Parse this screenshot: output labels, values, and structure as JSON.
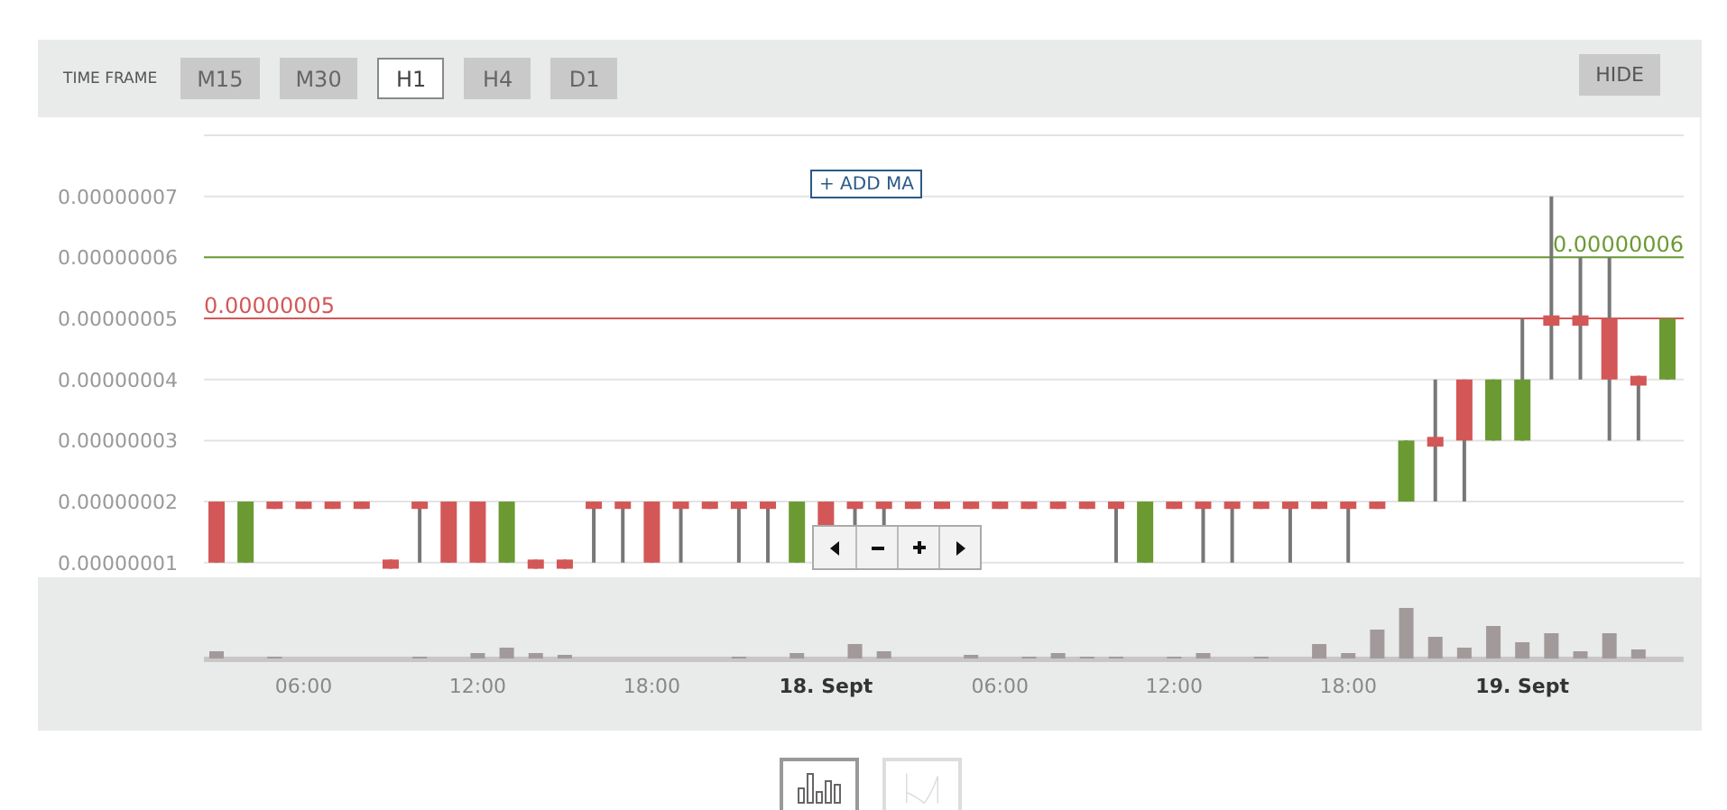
{
  "toolbar": {
    "label": "TIME FRAME",
    "timeframes": [
      {
        "label": "M15",
        "selected": false
      },
      {
        "label": "M30",
        "selected": false
      },
      {
        "label": "H1",
        "selected": true
      },
      {
        "label": "H4",
        "selected": false
      },
      {
        "label": "D1",
        "selected": false
      }
    ],
    "hide_button": "HIDE"
  },
  "add_ma_button": "+ ADD MA",
  "chart": {
    "y_axis_labels": [
      "0.00000007",
      "0.00000006",
      "0.00000005",
      "0.00000004",
      "0.00000003",
      "0.00000002",
      "0.00000001"
    ],
    "price_lines": [
      {
        "label": "0.00000006",
        "color": "#6b9a32"
      },
      {
        "label": "0.00000005",
        "color": "#d35757"
      }
    ],
    "x_axis_labels": [
      {
        "label": "06:00",
        "bold": false
      },
      {
        "label": "12:00",
        "bold": false
      },
      {
        "label": "18:00",
        "bold": false
      },
      {
        "label": "18. Sept",
        "bold": true
      },
      {
        "label": "06:00",
        "bold": false
      },
      {
        "label": "12:00",
        "bold": false
      },
      {
        "label": "18:00",
        "bold": false
      },
      {
        "label": "19. Sept",
        "bold": true
      }
    ]
  },
  "chart_types": [
    {
      "kind": "candles",
      "selected": true
    },
    {
      "kind": "line",
      "selected": false
    }
  ]
}
